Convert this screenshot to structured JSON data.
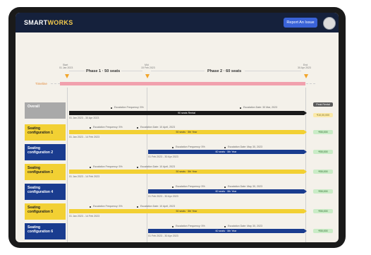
{
  "app": {
    "logo_main": "SMART",
    "logo_accent": "WORKS",
    "report_button": "Report An Issue"
  },
  "timeline": {
    "label": "Timeline",
    "phase1": "Phase 1 · 50 seats",
    "phase2": "Phase 2 · 60 seats",
    "milestones": [
      {
        "top": "Start",
        "bottom": "01 Jan 2023"
      },
      {
        "top": "Mid",
        "bottom": "15 Feb 2023"
      },
      {
        "top": "End",
        "bottom": "30 Apr 2023"
      }
    ]
  },
  "peak_header": "Peak Rental",
  "overall": {
    "label": "Overall",
    "freq_label": "Escalation Frequency: 5%",
    "date_label": "Escalation Date: 30 Mar, 2023",
    "bar_label": "90 seats Rental",
    "date_range": "01 Jan 2023 - 30 Apr 2023",
    "pill": "₹10,00,000"
  },
  "rows": [
    {
      "label": "Seating configuration 1",
      "freq_label": "Escalation Frequency: 5%",
      "date_label": "Escalation Date: 10 April, 2023",
      "bar_label": "50 seats · 5th Year",
      "date_range": "01 Jan 2023 - 14 Feb 2023",
      "pill": "₹55,000"
    },
    {
      "label": "Seating configuration 2",
      "freq_label": "Escalation Frequency: 5%",
      "date_label": "Escalation Date: May 30, 2023",
      "bar_label": "60 seats · 5th Year",
      "date_range": "01 Feb 2023 - 30 Apr 2023",
      "pill": "₹55,000"
    },
    {
      "label": "Seating configuration 3",
      "freq_label": "Escalation Frequency: 5%",
      "date_label": "Escalation Date: 10 April, 2023",
      "bar_label": "50 seats · 5th Year",
      "date_range": "01 Jan 2023 - 14 Feb 2023",
      "pill": "₹55,000"
    },
    {
      "label": "Seating configuration 4",
      "freq_label": "Escalation Frequency: 5%",
      "date_label": "Escalation Date: May 30, 2023",
      "bar_label": "60 seats · 5th Year",
      "date_range": "01 Feb 2023 - 30 Apr 2023",
      "pill": "₹55,000"
    },
    {
      "label": "Seating configuration 5",
      "freq_label": "Escalation Frequency: 5%",
      "date_label": "Escalation Date: 10 April, 2023",
      "bar_label": "50 seats · 5th Year",
      "date_range": "01 Jan 2023 - 14 Feb 2023",
      "pill": "₹55,000"
    },
    {
      "label": "Seating configuration 6",
      "freq_label": "Escalation Frequency: 5%",
      "date_label": "Escalation Date: May 30, 2023",
      "bar_label": "60 seats · 5th Year",
      "date_range": "01 Feb 2023 - 30 Apr 2023",
      "pill": "₹55,000"
    }
  ],
  "colors": {
    "topbar": "#15213c",
    "yellow": "#f2d033",
    "blue": "#1a3c8f",
    "timeline_pink": "#f1a0ad",
    "milestone_orange": "#f2a52a"
  }
}
